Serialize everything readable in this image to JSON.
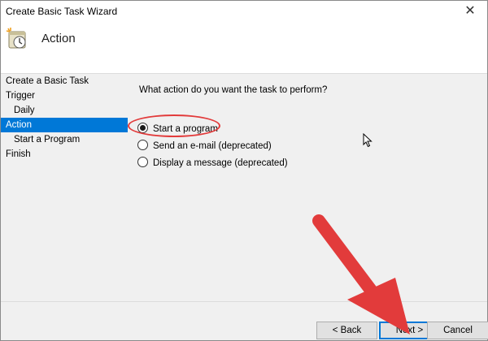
{
  "window": {
    "title": "Create Basic Task Wizard",
    "close_glyph": "✕"
  },
  "header": {
    "title": "Action",
    "icon": "task-scheduler-clock-icon"
  },
  "sidebar": {
    "items": [
      {
        "label": "Create a Basic Task",
        "indent": false,
        "selected": false
      },
      {
        "label": "Trigger",
        "indent": false,
        "selected": false
      },
      {
        "label": "Daily",
        "indent": true,
        "selected": false
      },
      {
        "label": "Action",
        "indent": false,
        "selected": true
      },
      {
        "label": "Start a Program",
        "indent": true,
        "selected": false
      },
      {
        "label": "Finish",
        "indent": false,
        "selected": false
      }
    ]
  },
  "main": {
    "question": "What action do you want the task to perform?",
    "options": [
      {
        "label": "Start a program",
        "checked": true
      },
      {
        "label": "Send an e-mail (deprecated)",
        "checked": false
      },
      {
        "label": "Display a message (deprecated)",
        "checked": false
      }
    ]
  },
  "footer": {
    "back_label": "< Back",
    "next_label": "Next >",
    "cancel_label": "Cancel"
  },
  "colors": {
    "selection": "#0078d7",
    "annotation": "#e23b3b"
  }
}
